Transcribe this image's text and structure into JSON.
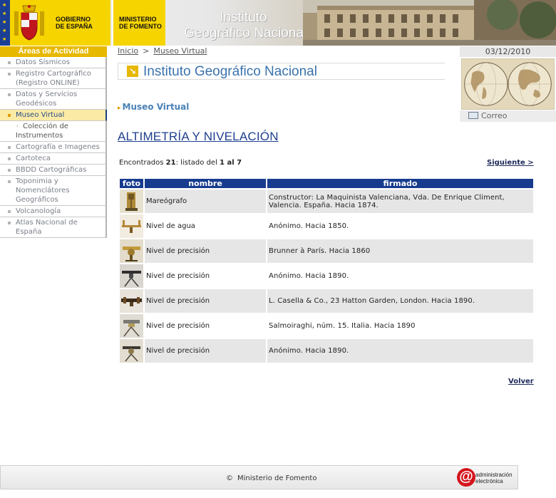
{
  "header": {
    "gov_line1": "GOBIERNO",
    "gov_line2": "DE ESPAÑA",
    "min_line1": "MINISTERIO",
    "min_line2": "DE FOMENTO",
    "site_title_line1": "Instituto",
    "site_title_line2": "Geográfico Nacional"
  },
  "sidebar": {
    "heading": "Áreas de Actividad",
    "items": [
      {
        "label": "Datos Sísmicos"
      },
      {
        "label": "Registro Cartográfico (Registro ONLINE)"
      },
      {
        "label": "Datos y Servicios Geodésicos"
      },
      {
        "label": "Museo Virtual"
      },
      {
        "label": "Colección de Instrumentos"
      },
      {
        "label": "Cartografía e Imagenes"
      },
      {
        "label": "Cartoteca"
      },
      {
        "label": "BBDD Cartográficas"
      },
      {
        "label": "Toponimia y Nomenclátores Geográficos"
      },
      {
        "label": "Volcanología"
      },
      {
        "label": "Atlas Nacional de España"
      }
    ]
  },
  "breadcrumb": {
    "home": "Inicio",
    "separator": ">",
    "current": "Museo Virtual"
  },
  "section": {
    "title": "Instituto Geográfico Nacional",
    "subtitle": "Museo Virtual"
  },
  "right": {
    "date": "03/12/2010",
    "mail_label": "Correo"
  },
  "main": {
    "heading": "ALTIMETRÍA Y NIVELACIÓN",
    "found_prefix": "Encontrados",
    "found_count": "21",
    "found_mid": ": listado del",
    "found_range": "1 al 7",
    "next_label": "Siguiente >",
    "back_label": "Volver"
  },
  "table": {
    "headers": [
      "foto",
      "nombre",
      "firmado"
    ],
    "rows": [
      {
        "nombre": "Mareógrafo",
        "firmado": "Constructor: La Maquinista Valenciana, Vda. De Enrique Climent, Valencia. España. Hacia 1874."
      },
      {
        "nombre": "Nivel de agua",
        "firmado": "Anónimo. Hacia 1850."
      },
      {
        "nombre": "Nivel de precisión",
        "firmado": "Brunner à París. Hacia 1860"
      },
      {
        "nombre": "Nivel de precisión",
        "firmado": "Anónimo. Hacia 1890."
      },
      {
        "nombre": "Nivel de precisión",
        "firmado": "L. Casella & Co., 23 Hatton Garden, London. Hacia 1890."
      },
      {
        "nombre": "Nivel de precisión",
        "firmado": "Salmoiraghi, núm. 15. Italia. Hacia 1890"
      },
      {
        "nombre": "Nivel de precisión",
        "firmado": "Anónimo. Hacia 1890."
      }
    ]
  },
  "footer": {
    "copyright_symbol": "©",
    "owner": "Ministerio de Fomento",
    "admin_line1": "administración",
    "admin_line2": "electrónica"
  },
  "colors": {
    "accent_yellow": "#e7b800",
    "table_header": "#173c8e",
    "link_blue": "#1e3f8f",
    "section_blue": "#3a72ad"
  }
}
